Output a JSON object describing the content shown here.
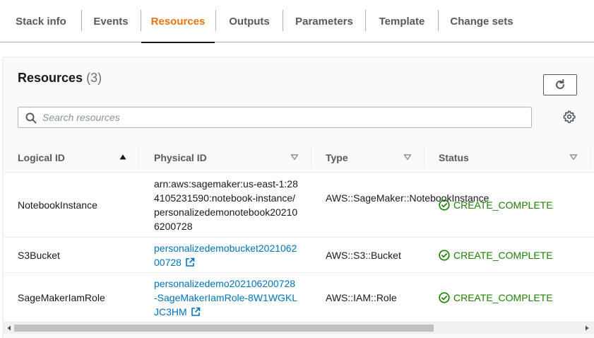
{
  "tabs": [
    {
      "label": "Stack info"
    },
    {
      "label": "Events"
    },
    {
      "label": "Resources"
    },
    {
      "label": "Outputs"
    },
    {
      "label": "Parameters"
    },
    {
      "label": "Template"
    },
    {
      "label": "Change sets"
    }
  ],
  "active_tab": "Resources",
  "resources": {
    "title": "Resources",
    "count": "(3)",
    "search_placeholder": "Search resources",
    "columns": [
      {
        "label": "Logical ID",
        "sort": "ascending"
      },
      {
        "label": "Physical ID",
        "sort": "none"
      },
      {
        "label": "Type",
        "sort": "none"
      },
      {
        "label": "Status",
        "sort": "none"
      }
    ],
    "rows": [
      {
        "logical_id": "NotebookInstance",
        "physical_id": "arn:aws:sagemaker:us-east-1:284105231590:notebook-instance/personalizedemonotebook202106200728",
        "physical_is_link": false,
        "type": "AWS::SageMaker::NotebookInstance",
        "status": "CREATE_COMPLETE"
      },
      {
        "logical_id": "S3Bucket",
        "physical_id": "personalizedemobucket202106200728",
        "physical_is_link": true,
        "type": "AWS::S3::Bucket",
        "status": "CREATE_COMPLETE"
      },
      {
        "logical_id": "SageMakerIamRole",
        "physical_id": "personalizedemo202106200728-SageMakerIamRole-8W1WGKLJC3HM",
        "physical_is_link": true,
        "type": "AWS::IAM::Role",
        "status": "CREATE_COMPLETE"
      }
    ]
  },
  "colors": {
    "accent": "#ec7211",
    "link": "#0073bb",
    "success": "#1d8102",
    "tab_text": "#545b64"
  },
  "icons": {
    "refresh": "refresh-icon",
    "search": "search-icon",
    "settings": "gear-icon",
    "sort_ascending": "sort-ascending-icon",
    "sort_none": "sort-none-icon",
    "status_success": "check-circle-icon",
    "external_link": "external-link-icon"
  },
  "scrollbar": {
    "position_fraction": 0.0,
    "visible_fraction": 0.73
  }
}
